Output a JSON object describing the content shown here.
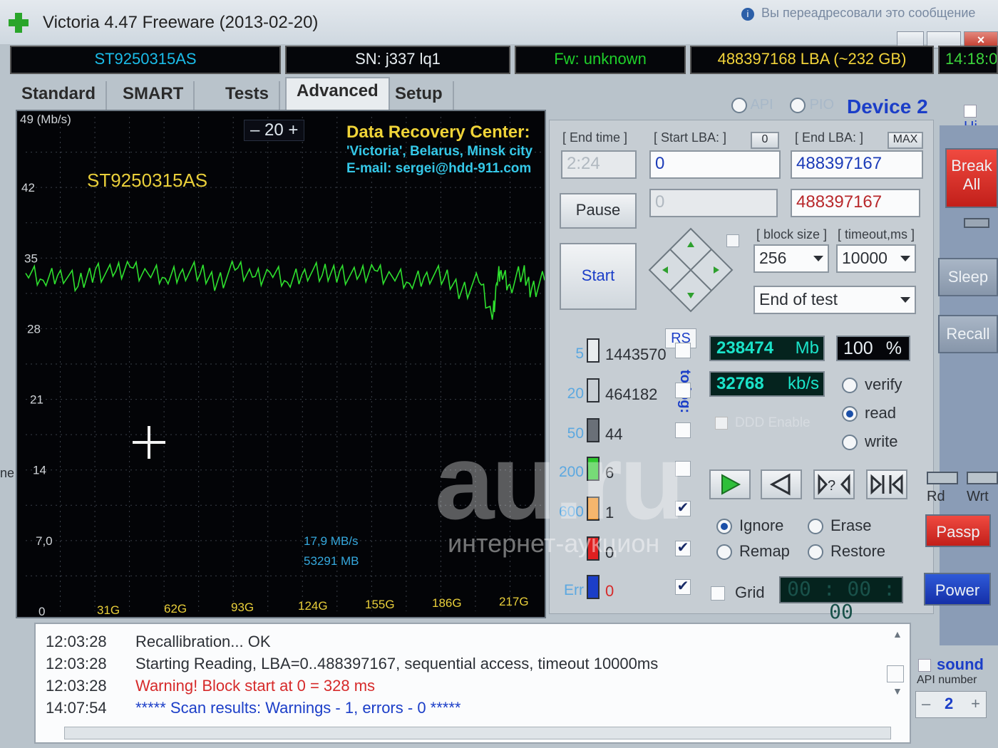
{
  "window": {
    "title": "Victoria 4.47  Freeware (2013-02-20)",
    "notification": "Вы переадресовали это сообщение"
  },
  "info": {
    "model": "ST9250315AS",
    "serial": "SN: j337      lq1",
    "firmware": "Fw: unknown",
    "lba": "488397168 LBA (~232 GB)",
    "clock": "14:18:0"
  },
  "tabs": [
    "Standard",
    "SMART",
    "Tests",
    "Advanced",
    "Setup"
  ],
  "interface": {
    "api_label": "API",
    "pio_label": "PIO",
    "device": "Device 2",
    "hints": "Hi"
  },
  "graph": {
    "y_unit": "49 (Mb/s)",
    "drive_label": "ST9250315AS",
    "counter": "–  20  +",
    "drc_title": "Data Recovery Center:",
    "drc_line2": "'Victoria', Belarus, Minsk city",
    "drc_line3": "E-mail: sergei@hdd-911.com",
    "current_speed": "17,9 MB/s",
    "current_pos": "53291 MB"
  },
  "chart_data": {
    "type": "line",
    "y_ticks": [
      "42",
      "35",
      "28",
      "21",
      "14",
      "7,0",
      "0"
    ],
    "x_ticks": [
      "31G",
      "62G",
      "93G",
      "124G",
      "155G",
      "186G",
      "217G"
    ],
    "ylim": [
      0,
      49
    ],
    "xlim": [
      0,
      238
    ],
    "ylabel": "49 (Mb/s)",
    "series": [
      {
        "color": "#2ee02e",
        "x": [
          0,
          8,
          16,
          24,
          32,
          40,
          48,
          56,
          64,
          72,
          80,
          88,
          96,
          104,
          112,
          120,
          128,
          136,
          144,
          152,
          160,
          168,
          176,
          184,
          192,
          200,
          208,
          214,
          216,
          218,
          222,
          228,
          232,
          238
        ],
        "y": [
          33.5,
          32.8,
          33.8,
          32.2,
          33.9,
          33.2,
          34.1,
          33.5,
          33.0,
          33.9,
          33.4,
          32.7,
          33.8,
          33.1,
          33.6,
          32.6,
          33.9,
          33.3,
          33.7,
          32.9,
          33.8,
          33.2,
          32.5,
          33.6,
          33.0,
          31.8,
          32.6,
          28.9,
          32.5,
          33.8,
          32.4,
          33.5,
          31.9,
          32.8
        ]
      }
    ]
  },
  "controls": {
    "end_time_label": "[ End time ]",
    "end_time": "2:24",
    "start_lba_label": "[ Start LBA: ]",
    "start_lba_btn": "0",
    "start_lba": "0",
    "start_lba_current": "0",
    "end_lba_label": "[ End LBA: ]",
    "end_lba_btn": "MAX",
    "end_lba": "488397167",
    "end_lba_current": "488397167",
    "pause": "Pause",
    "start": "Start",
    "block_size_label": "[ block size ]",
    "block_size": "256",
    "timeout_label": "[ timeout,ms ]",
    "timeout": "10000",
    "end_action": "End of test",
    "rs": "RS",
    "to_log": "to log:"
  },
  "legend": [
    {
      "threshold": "5",
      "count": "1443570",
      "color": "#e8ecef",
      "checked": ""
    },
    {
      "threshold": "20",
      "count": "464182",
      "color": "#c8ced4",
      "checked": ""
    },
    {
      "threshold": "50",
      "count": "44",
      "color": "#6a7078",
      "checked": ""
    },
    {
      "threshold": "200",
      "count": "6",
      "color": "#2ec82e",
      "checked": ""
    },
    {
      "threshold": "600",
      "count": "1",
      "color": "#f09020",
      "checked": "✔"
    },
    {
      "threshold": "",
      "count": "0",
      "color": "#e02020",
      "checked": "✔"
    },
    {
      "threshold": "Err",
      "count": "0",
      "color": "#1b3ec8",
      "checked": "✔"
    }
  ],
  "stats": {
    "megabytes": "238474",
    "mb_unit": "Mb",
    "percent": "100",
    "pct_unit": "%",
    "speed": "32768",
    "speed_unit": "kb/s",
    "ddd": "DDD Enable"
  },
  "mode": {
    "verify": "verify",
    "read": "read",
    "write": "write"
  },
  "repair": {
    "ignore": "Ignore",
    "erase": "Erase",
    "remap": "Remap",
    "restore": "Restore",
    "grid": "Grid",
    "timer": "00 : 00 : 00"
  },
  "side": {
    "break_all_1": "Break",
    "break_all_2": "All",
    "sleep": "Sleep",
    "recall": "Recall",
    "rd": "Rd",
    "wrt": "Wrt",
    "passp": "Passp",
    "power": "Power",
    "sound": "sound",
    "api_number_label": "API number",
    "api_number": "2"
  },
  "log": [
    {
      "time": "12:03:28",
      "msg": "Recallibration... OK"
    },
    {
      "time": "12:03:28",
      "msg": "Starting Reading, LBA=0..488397167, sequential access, timeout 10000ms"
    },
    {
      "time": "12:03:28",
      "msg": "Warning! Block start at 0 = 328 ms"
    },
    {
      "time": "14:07:54",
      "msg": "***** Scan results: Warnings - 1, errors - 0 *****"
    }
  ],
  "watermark": {
    "main": "au.ru",
    "sub": "интернет-аукцион"
  },
  "edge_text": "ne"
}
